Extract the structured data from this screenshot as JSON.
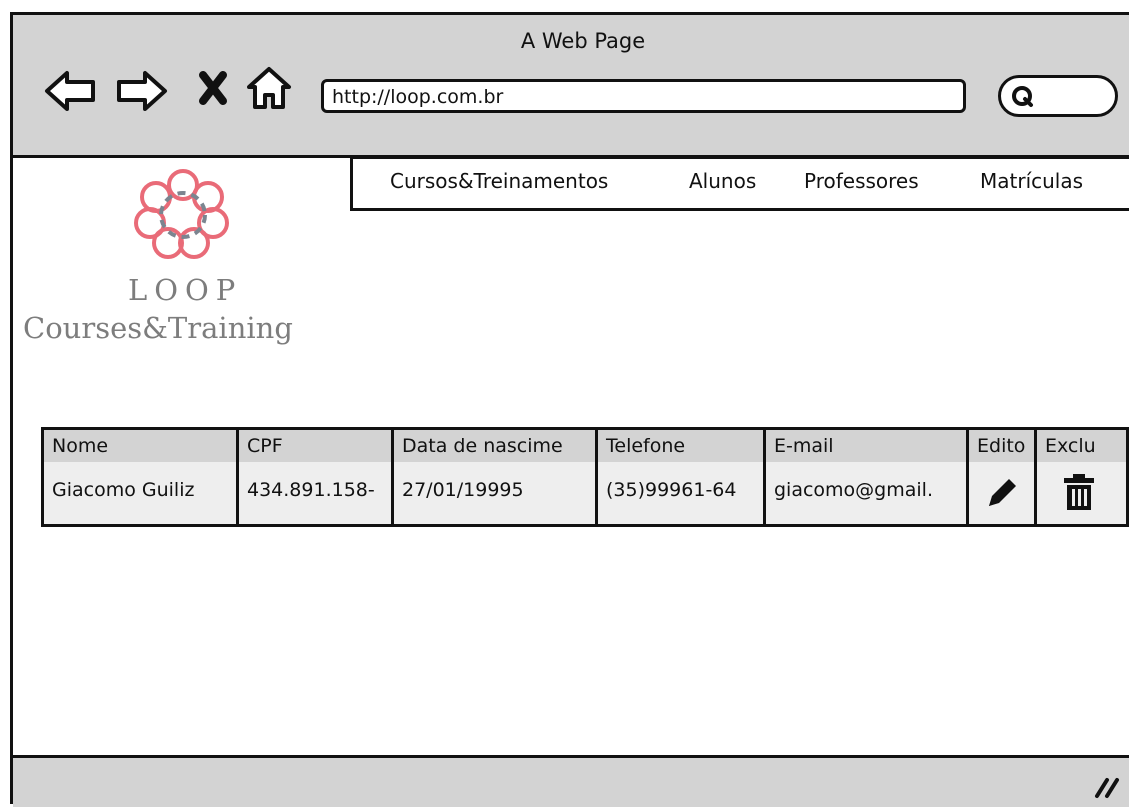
{
  "window": {
    "title": "A Web Page"
  },
  "nav": {
    "back_icon": "back-arrow-icon",
    "forward_icon": "forward-arrow-icon",
    "stop_icon": "close-icon",
    "home_icon": "home-icon",
    "url": "http://loop.com.br",
    "search_icon": "search-icon"
  },
  "menu": {
    "items": [
      "Cursos&Treinamentos",
      "Alunos",
      "Professores",
      "Matrículas"
    ]
  },
  "logo": {
    "name": "LOOP",
    "subtitle": "Courses&Training",
    "colors": {
      "accent": "#e96b78",
      "secondary": "#7b8590",
      "text": "#7d7d7d"
    }
  },
  "table": {
    "headers": [
      "Nome",
      "CPF",
      "Data de nascime",
      "Telefone",
      "E-mail",
      "Edito",
      "Exclu"
    ],
    "rows": [
      {
        "nome": "Giacomo Guiliz",
        "cpf": "434.891.158-",
        "data_nascimento": "27/01/19995",
        "telefone": "(35)99961-64",
        "email": "giacomo@gmail.",
        "edit_icon": "pencil-icon",
        "delete_icon": "trash-icon"
      }
    ]
  },
  "colors": {
    "chrome": "#d3d3d3",
    "header": "#d3d3d3",
    "row": "#eeeeee",
    "border": "#111111"
  }
}
